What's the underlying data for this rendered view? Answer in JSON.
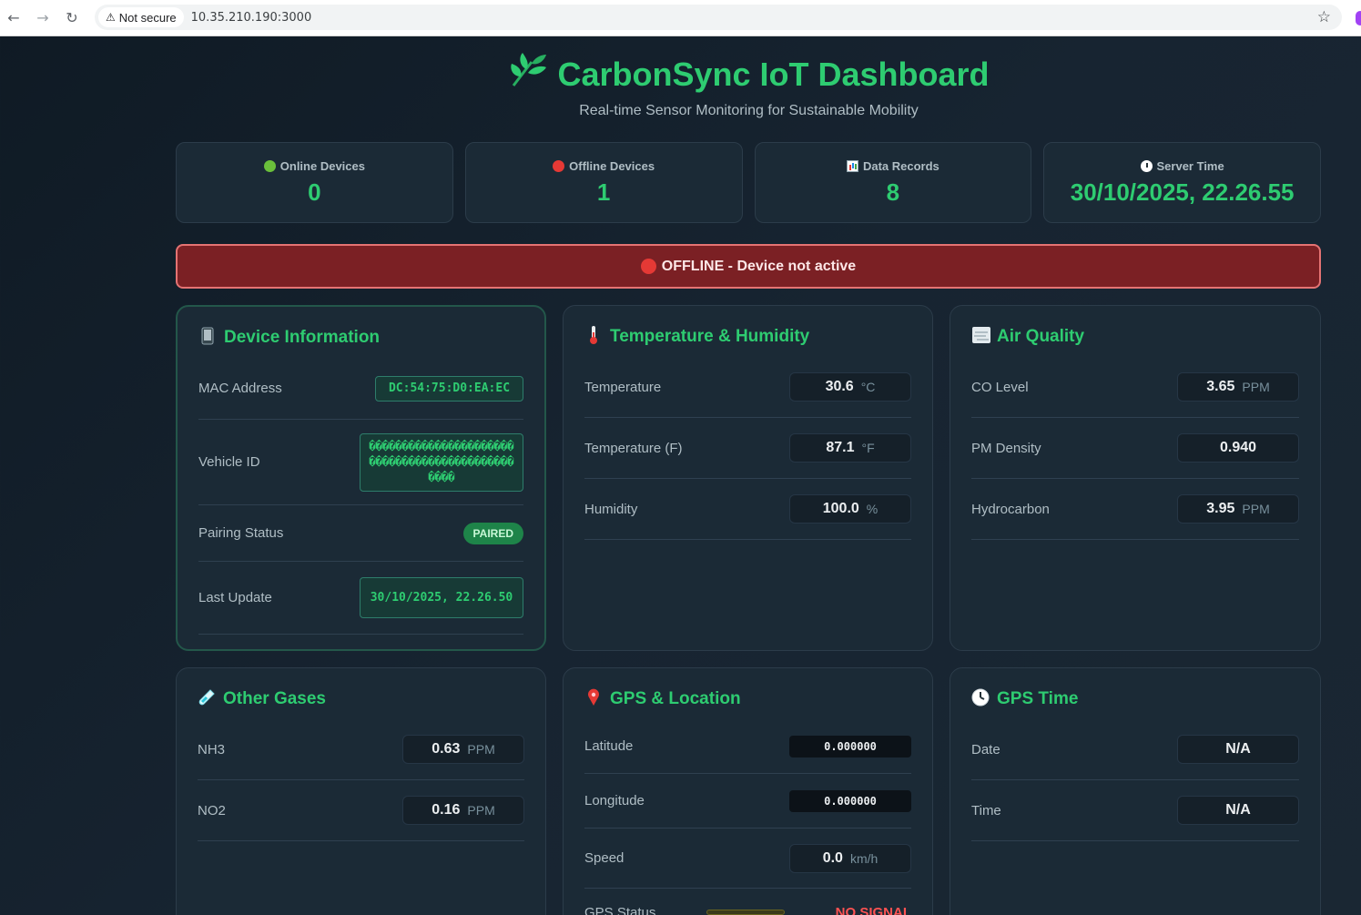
{
  "browser": {
    "security_label": "Not secure",
    "url": "10.35.210.190:3000"
  },
  "header": {
    "title": "CarbonSync IoT Dashboard",
    "subtitle": "Real-time Sensor Monitoring for Sustainable Mobility",
    "accent_color": "#2ecc71"
  },
  "stats": [
    {
      "icon": "green-circle-icon",
      "label": "Online Devices",
      "value": "0"
    },
    {
      "icon": "red-circle-icon",
      "label": "Offline Devices",
      "value": "1"
    },
    {
      "icon": "bar-chart-icon",
      "label": "Data Records",
      "value": "8"
    },
    {
      "icon": "clock-icon",
      "label": "Server Time",
      "value": "30/10/2025, 22.26.55"
    }
  ],
  "banner": {
    "text": "OFFLINE - Device not active",
    "color": "#7b2024"
  },
  "device_info": {
    "title": "Device Information",
    "mac_label": "MAC Address",
    "mac_value": "DC:54:75:D0:EA:EC",
    "vehicle_label": "Vehicle ID",
    "vehicle_value": "������������������������������������������������",
    "pairing_label": "Pairing Status",
    "pairing_value": "PAIRED",
    "last_update_label": "Last Update",
    "last_update_value": "30/10/2025, 22.26.50"
  },
  "temperature": {
    "title": "Temperature & Humidity",
    "rows": [
      {
        "label": "Temperature",
        "value": "30.6",
        "unit": "°C"
      },
      {
        "label": "Temperature (F)",
        "value": "87.1",
        "unit": "°F"
      },
      {
        "label": "Humidity",
        "value": "100.0",
        "unit": "%"
      }
    ]
  },
  "air_quality": {
    "title": "Air Quality",
    "rows": [
      {
        "label": "CO Level",
        "value": "3.65",
        "unit": "PPM"
      },
      {
        "label": "PM Density",
        "value": "0.940",
        "unit": ""
      },
      {
        "label": "Hydrocarbon",
        "value": "3.95",
        "unit": "PPM"
      }
    ]
  },
  "other_gases": {
    "title": "Other Gases",
    "rows": [
      {
        "label": "NH3",
        "value": "0.63",
        "unit": "PPM"
      },
      {
        "label": "NO2",
        "value": "0.16",
        "unit": "PPM"
      }
    ]
  },
  "gps": {
    "title": "GPS & Location",
    "latitude_label": "Latitude",
    "latitude_value": "0.000000",
    "longitude_label": "Longitude",
    "longitude_value": "0.000000",
    "speed_label": "Speed",
    "speed_value": "0.0",
    "speed_unit": "km/h",
    "status_label": "GPS Status",
    "status_value": "NO SIGNAL"
  },
  "gps_time": {
    "title": "GPS Time",
    "date_label": "Date",
    "date_value": "N/A",
    "time_label": "Time",
    "time_value": "N/A"
  }
}
